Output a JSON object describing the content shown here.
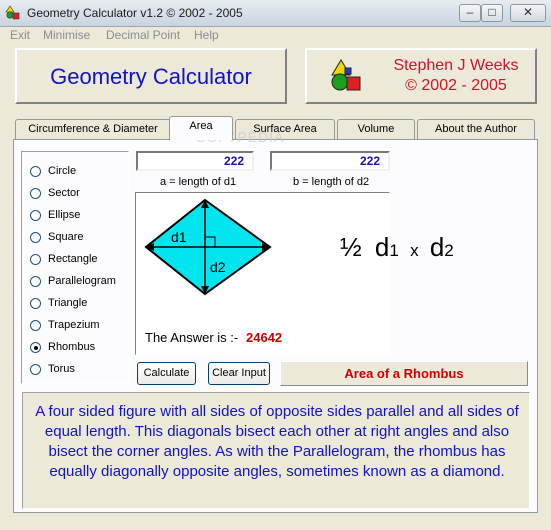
{
  "window": {
    "title": "Geometry Calculator v1.2 ©  2002 - 2005"
  },
  "menu": [
    "Exit",
    "Minimise",
    "Decimal Point",
    "Help"
  ],
  "header": {
    "app_name": "Geometry Calculator",
    "author_line1": "Stephen J Weeks",
    "author_line2": "© 2002 - 2005"
  },
  "tabs": [
    "Circumference & Diameter",
    "Area",
    "Surface Area",
    "Volume",
    "About the Author"
  ],
  "shapes": [
    "Circle",
    "Sector",
    "Ellipse",
    "Square",
    "Rectangle",
    "Parallelogram",
    "Triangle",
    "Trapezium",
    "Rhombus",
    "Torus"
  ],
  "selected_shape": "Rhombus",
  "inputs": {
    "a_value": "222",
    "b_value": "222",
    "a_caption": "a = length of d1",
    "b_caption": "b = length of d2"
  },
  "diagram": {
    "d1_label": "d1",
    "d2_label": "d2",
    "fill_color": "#00E5EE"
  },
  "formula": {
    "half": "½",
    "d1": "d",
    "d1_sub": "1",
    "times": "x",
    "d2": "d",
    "d2_sub": "2"
  },
  "answer": {
    "label": "The Answer is :-",
    "value": "24642"
  },
  "buttons": {
    "calculate": "Calculate",
    "clear": "Clear Input"
  },
  "result_title": "Area of a Rhombus",
  "description": "A four sided figure with all sides of opposite sides parallel and all sides of equal length. This diagonals bisect each other at right angles and also bisect the corner angles. As with the Parallelogram, the rhombus has equally diagonally opposite angles, sometimes known as a diamond.",
  "watermark": "SOFTPEDIA",
  "colors": {
    "heading_blue": "#1212C8",
    "author_red": "#D8102A",
    "answer_red": "#D00000"
  }
}
